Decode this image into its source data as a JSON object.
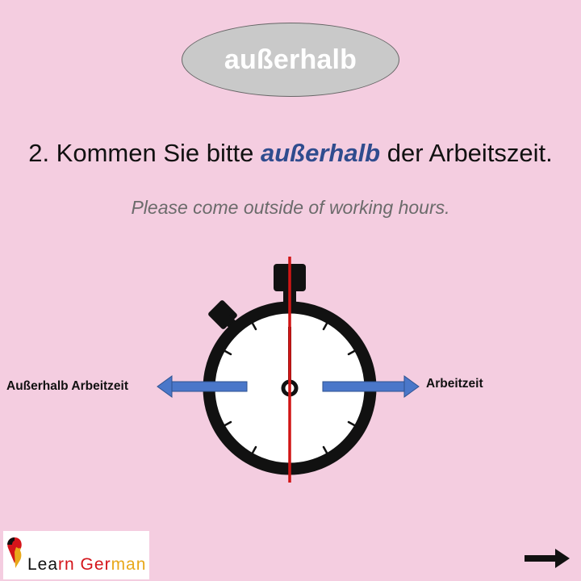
{
  "title_word": "außerhalb",
  "sentence": {
    "before": "2. Kommen Sie bitte ",
    "highlight": "außerhalb",
    "after": " der Arbeitszeit."
  },
  "translation": "Please come outside of working hours.",
  "diagram": {
    "left_label": "Außerhalb Arbeitzeit",
    "right_label": "Arbeitzeit"
  },
  "logo": {
    "part1": "Lea",
    "part2": "rn Ger",
    "part3": "man"
  },
  "icons": {
    "next": "arrow-right-icon",
    "stopwatch": "stopwatch-icon",
    "logo_mark": "map-pin-icon"
  },
  "colors": {
    "background": "#f4cde0",
    "highlight": "#2f4c8e",
    "arrow": "#4a77c9",
    "divider": "#d01515"
  }
}
